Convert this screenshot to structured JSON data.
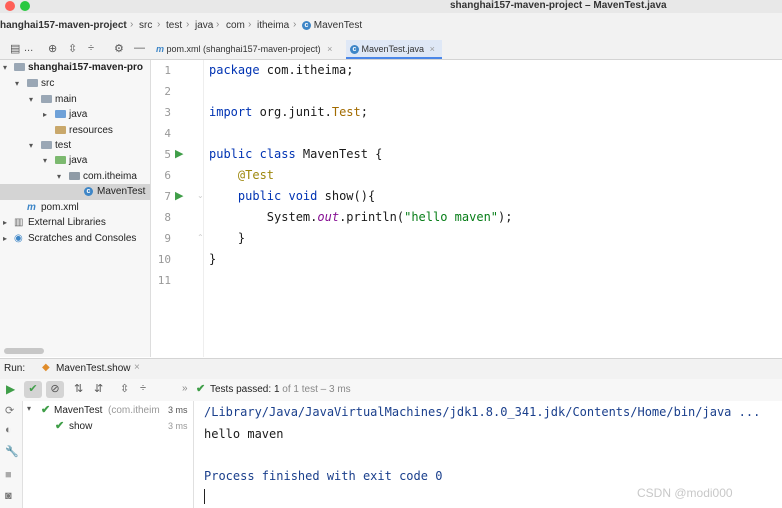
{
  "window": {
    "title": "shanghai157-maven-project – MavenTest.java"
  },
  "breadcrumbs": [
    "hanghai157-maven-project",
    "src",
    "test",
    "java",
    "com",
    "itheima",
    "MavenTest"
  ],
  "toolbar": {
    "project_label": "..."
  },
  "tabs": [
    {
      "label": "pom.xml (shanghai157-maven-project)",
      "icon": "maven-icon",
      "active": false
    },
    {
      "label": "MavenTest.java",
      "icon": "class-icon",
      "active": true
    }
  ],
  "tree": {
    "items": [
      {
        "label": "shanghai157-maven-pro",
        "depth": 0,
        "expanded": true,
        "icon": "module-folder"
      },
      {
        "label": "src",
        "depth": 1,
        "expanded": true,
        "icon": "folder"
      },
      {
        "label": "main",
        "depth": 2,
        "expanded": true,
        "icon": "folder"
      },
      {
        "label": "java",
        "depth": 3,
        "expanded": false,
        "icon": "source-folder"
      },
      {
        "label": "resources",
        "depth": 3,
        "expanded": null,
        "icon": "resources-folder"
      },
      {
        "label": "test",
        "depth": 2,
        "expanded": true,
        "icon": "folder"
      },
      {
        "label": "java",
        "depth": 3,
        "expanded": true,
        "icon": "test-folder"
      },
      {
        "label": "com.itheima",
        "depth": 4,
        "expanded": true,
        "icon": "package"
      },
      {
        "label": "MavenTest",
        "depth": 5,
        "expanded": null,
        "icon": "class",
        "selected": true
      },
      {
        "label": "pom.xml",
        "depth": 1,
        "expanded": null,
        "icon": "maven"
      },
      {
        "label": "External Libraries",
        "depth": 0,
        "expanded": false,
        "icon": "libraries"
      },
      {
        "label": "Scratches and Consoles",
        "depth": 0,
        "expanded": false,
        "icon": "scratches"
      }
    ]
  },
  "editor": {
    "line_numbers": [
      "1",
      "2",
      "3",
      "4",
      "5",
      "6",
      "7",
      "8",
      "9",
      "10",
      "11"
    ],
    "current_line": 11
  },
  "run": {
    "label": "Run:",
    "config_tab": "MavenTest.show",
    "status_prefix": "Tests passed:",
    "status_count": "1",
    "status_rest": "of 1 test",
    "status_time": "– 3 ms",
    "tests": [
      {
        "name": "MavenTest",
        "detail": "(com.itheim",
        "time": "3 ms"
      },
      {
        "name": "show",
        "detail": "",
        "time": "3 ms"
      }
    ],
    "console": [
      "/Library/Java/JavaVirtualMachines/jdk1.8.0_341.jdk/Contents/Home/bin/java ...",
      "hello maven",
      "",
      "Process finished with exit code 0"
    ]
  },
  "watermark": "CSDN @modi000",
  "colors": {
    "accent": "#4a86e8",
    "keyword": "#0033b3",
    "string": "#067d17",
    "annotation": "#9e880d",
    "pass": "#3f9e48"
  }
}
